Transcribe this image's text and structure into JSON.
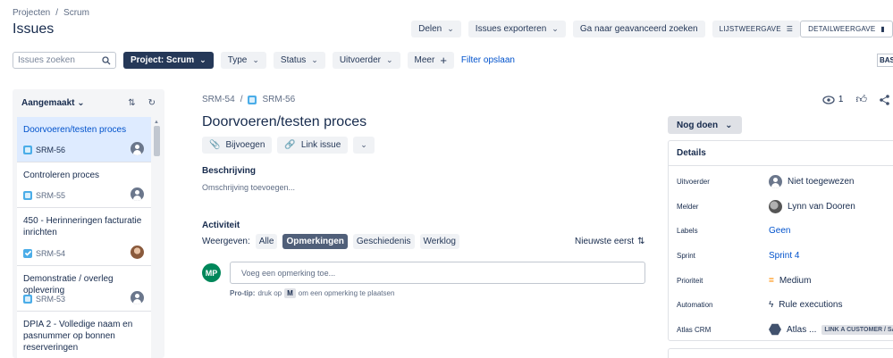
{
  "breadcrumb": [
    "Projecten",
    "/",
    "Scrum"
  ],
  "page_title": "Issues",
  "top_actions": {
    "share": "Delen",
    "export": "Issues exporteren",
    "advanced": "Ga naar geavanceerd zoeken",
    "list_view": "LIJSTWEERGAVE",
    "detail_view": "DETAILWEERGAVE"
  },
  "filters": {
    "search_placeholder": "Issues zoeken",
    "project": "Project: Scrum",
    "type": "Type",
    "status": "Status",
    "assignee": "Uitvoerder",
    "more": "Meer",
    "save_filter": "Filter opslaan",
    "bas": "BAS"
  },
  "sidebar": {
    "sort_label": "Aangemaakt",
    "items": [
      {
        "title": "Doorvoeren/testen proces",
        "key": "SRM-56",
        "type": "story",
        "avatar": "unassigned"
      },
      {
        "title": "Controleren proces",
        "key": "SRM-55",
        "type": "story",
        "avatar": "unassigned"
      },
      {
        "title": "450 - Herinneringen facturatie inrichten",
        "key": "SRM-54",
        "type": "task",
        "avatar": "photo"
      },
      {
        "title": "Demonstratie / overleg oplevering",
        "key": "SRM-53",
        "type": "story",
        "avatar": "unassigned"
      },
      {
        "title": "DPIA 2 - Volledige naam en pasnummer op bonnen reserveringen",
        "key": "",
        "type": "story",
        "avatar": "none"
      }
    ]
  },
  "issue": {
    "parent_key": "SRM-54",
    "key": "SRM-56",
    "title": "Doorvoeren/testen proces",
    "attach": "Bijvoegen",
    "link_issue": "Link issue",
    "description_label": "Beschrijving",
    "description_placeholder": "Omschrijving toevoegen...",
    "activity_label": "Activiteit",
    "show_label": "Weergeven:",
    "tabs": [
      "Alle",
      "Opmerkingen",
      "Geschiedenis",
      "Werklog"
    ],
    "sort": "Nieuwste eerst",
    "user_initials": "MP",
    "comment_placeholder": "Voeg een opmerking toe...",
    "protip_bold": "Pro-tip:",
    "protip_pre": "druk op",
    "protip_key": "M",
    "protip_post": "om een opmerking te plaatsen",
    "watchers": "1"
  },
  "status": "Nog doen",
  "details": {
    "heading": "Details",
    "assignee_label": "Uitvoerder",
    "assignee_value": "Niet toegewezen",
    "reporter_label": "Melder",
    "reporter_value": "Lynn van Dooren",
    "labels_label": "Labels",
    "labels_value": "Geen",
    "sprint_label": "Sprint",
    "sprint_value": "Sprint 4",
    "priority_label": "Prioriteit",
    "priority_value": "Medium",
    "automation_label": "Automation",
    "automation_value": "Rule executions",
    "crm_label": "Atlas CRM",
    "crm_value": "Atlas ...",
    "crm_badge": "LINK A CUSTOMER / SAL"
  }
}
